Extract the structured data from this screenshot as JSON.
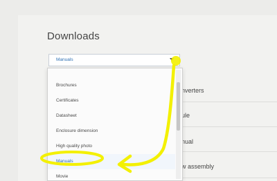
{
  "page": {
    "title": "Downloads"
  },
  "select": {
    "value": "Manuals"
  },
  "dropdown": {
    "options": [
      {
        "label": "Brochures",
        "selected": false
      },
      {
        "label": "Certificates",
        "selected": false
      },
      {
        "label": "Datasheet",
        "selected": false
      },
      {
        "label": "Enclosure dimension",
        "selected": false
      },
      {
        "label": "High quality photo",
        "selected": false
      },
      {
        "label": "Manuals",
        "selected": true
      },
      {
        "label": "Movie",
        "selected": false
      }
    ]
  },
  "background_list": [
    {
      "label": "nverters"
    },
    {
      "label": "ule"
    },
    {
      "label": "nual"
    },
    {
      "label": "w assembly"
    }
  ],
  "colors": {
    "annotation": "#f3f000",
    "selected_text": "#2d6fb3"
  }
}
